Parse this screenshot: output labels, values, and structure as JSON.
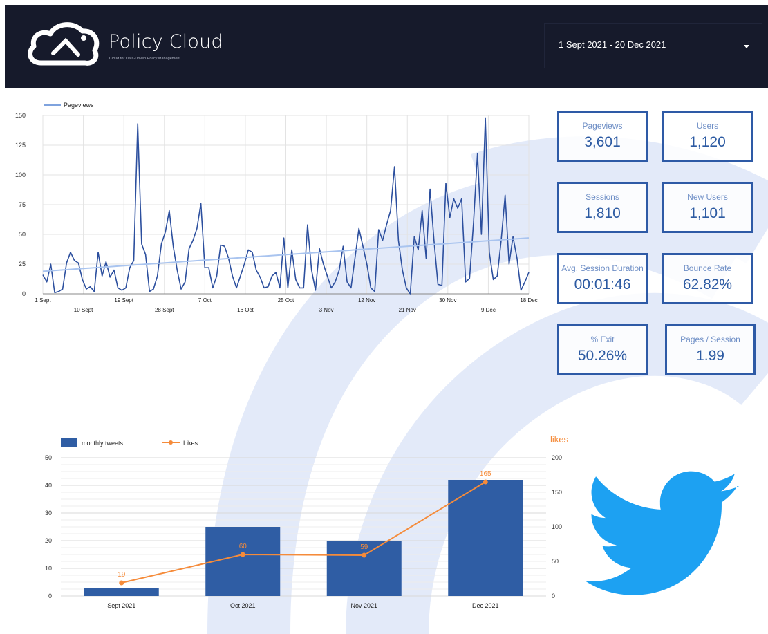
{
  "header": {
    "title": "Policy Cloud",
    "tagline": "Cloud for Data-Driven Policy Management",
    "date_range": "1 Sept 2021 - 20 Dec 2021",
    "background": "#161a2b"
  },
  "kpis": {
    "pageviews": {
      "label": "Pageviews",
      "value": "3,601"
    },
    "users": {
      "label": "Users",
      "value": "1,120"
    },
    "sessions": {
      "label": "Sessions",
      "value": "1,810"
    },
    "new_users": {
      "label": "New Users",
      "value": "1,101"
    },
    "avg_session": {
      "label": "Avg. Session Duration",
      "value": "00:01:46"
    },
    "bounce": {
      "label": "Bounce Rate",
      "value": "62.82%"
    },
    "exit": {
      "label": "% Exit",
      "value": "50.26%"
    },
    "pages_session": {
      "label": "Pages / Session",
      "value": "1.99"
    }
  },
  "icons": {
    "logo": "policy-cloud-logo-icon",
    "twitter": "twitter-bird-icon",
    "caret": "caret-down-icon"
  },
  "colors": {
    "accent": "#2e5aa6",
    "line": "#2c4f9e",
    "trend": "#a9c4ef",
    "likes": "#f58b3a",
    "watermark": "#dfe7f8"
  },
  "chart_data": [
    {
      "type": "line",
      "series": [
        {
          "name": "Pageviews",
          "values": [
            16,
            10,
            25,
            1,
            2,
            4,
            26,
            35,
            28,
            26,
            12,
            4,
            6,
            2,
            35,
            15,
            27,
            14,
            20,
            5,
            3,
            5,
            22,
            28,
            143,
            42,
            33,
            2,
            4,
            15,
            42,
            52,
            70,
            40,
            20,
            4,
            10,
            38,
            45,
            55,
            76,
            22,
            22,
            5,
            15,
            41,
            40,
            30,
            15,
            5,
            15,
            25,
            37,
            35,
            20,
            14,
            5,
            6,
            15,
            18,
            5,
            47,
            5,
            37,
            12,
            5,
            5,
            58,
            20,
            3,
            38,
            25,
            15,
            5,
            10,
            20,
            40,
            10,
            5,
            30,
            55,
            40,
            25,
            5,
            2,
            54,
            45,
            58,
            70,
            107,
            45,
            20,
            5,
            0,
            48,
            37,
            70,
            30,
            88,
            45,
            8,
            7,
            93,
            64,
            80,
            72,
            80,
            10,
            13,
            60,
            118,
            50,
            148,
            35,
            12,
            15,
            45,
            83,
            25,
            48,
            30,
            3,
            10,
            18
          ]
        }
      ],
      "trend": {
        "start": 19,
        "end": 47
      },
      "x_start": "2021-09-01",
      "x_end": "2021-12-20",
      "x_ticks_upper": [
        "1 Sept",
        "19 Sept",
        "7 Oct",
        "25 Oct",
        "12 Nov",
        "30 Nov",
        "18 Dec"
      ],
      "x_ticks_lower": [
        "10 Sept",
        "28 Sept",
        "16 Oct",
        "3 Nov",
        "21 Nov",
        "9 Dec"
      ],
      "y_ticks": [
        0,
        25,
        50,
        75,
        100,
        125,
        150
      ],
      "ylim": [
        0,
        150
      ],
      "grid": true,
      "legend": "top-left"
    },
    {
      "type": "bar",
      "categories": [
        "Sept 2021",
        "Oct 2021",
        "Nov 2021",
        "Dec 2021"
      ],
      "series": [
        {
          "name": "monthly tweets",
          "type": "bar",
          "values": [
            3,
            25,
            20,
            42
          ],
          "axis": "left"
        },
        {
          "name": "Likes",
          "type": "line",
          "values": [
            19,
            60,
            59,
            165
          ],
          "axis": "right"
        }
      ],
      "ylim_left": [
        0,
        50
      ],
      "y_ticks_left": [
        0,
        10,
        20,
        30,
        40,
        50
      ],
      "ylim_right": [
        0,
        200
      ],
      "y_ticks_right": [
        0,
        50,
        100,
        150,
        200
      ],
      "right_axis_label": "likes",
      "grid": true,
      "legend": "top-left"
    }
  ]
}
